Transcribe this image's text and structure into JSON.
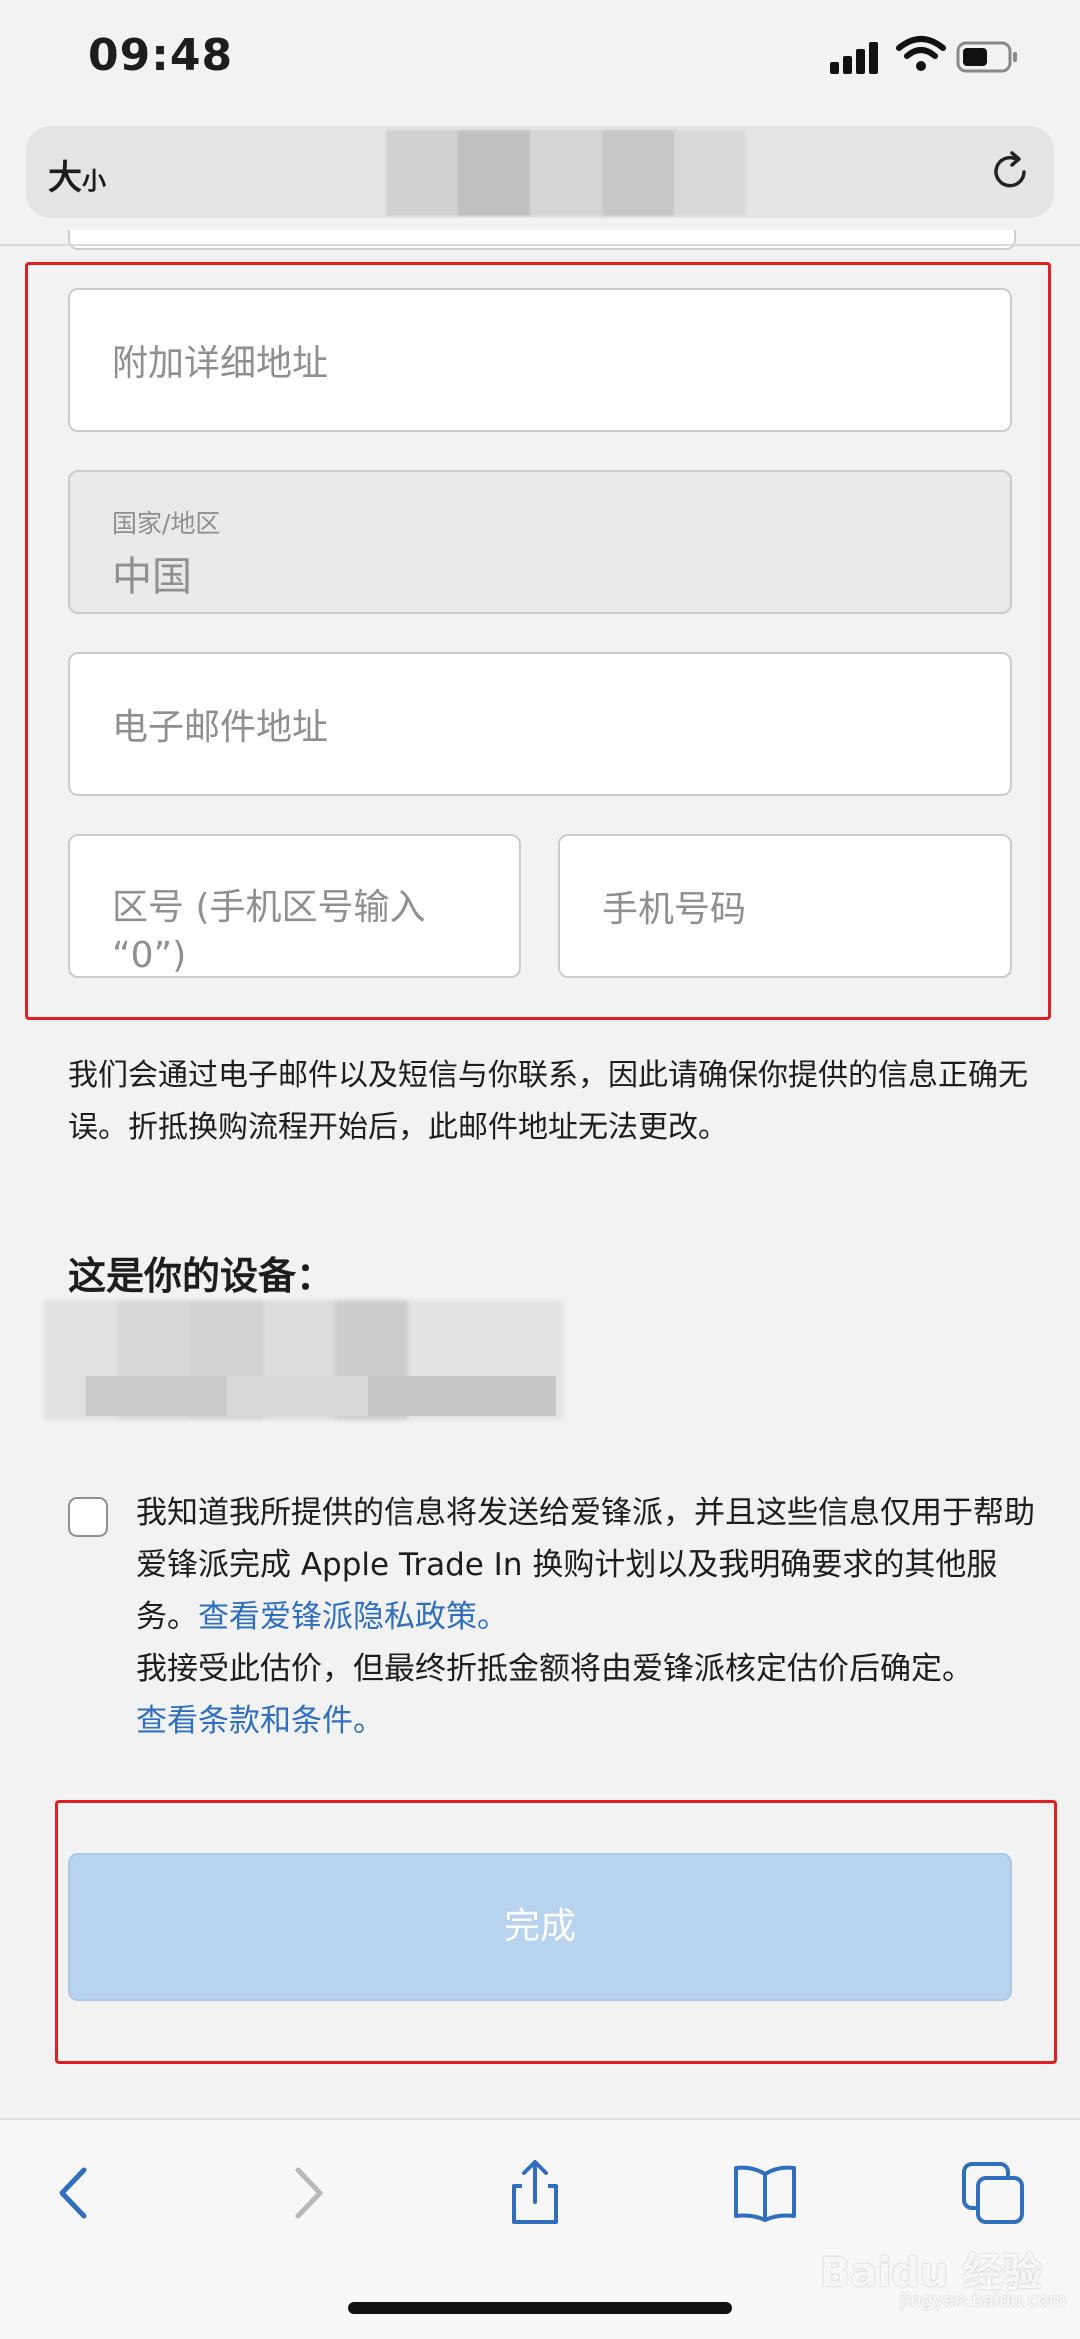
{
  "status_bar": {
    "time": "09:48"
  },
  "browser": {
    "text_size_label": "大",
    "text_size_small": "小"
  },
  "form": {
    "address_extra_placeholder": "附加详细地址",
    "country_label": "国家/地区",
    "country_value": "中国",
    "email_placeholder": "电子邮件地址",
    "area_code_placeholder_line1": "区号 (手机区号输入",
    "area_code_placeholder_line2": "“0”)",
    "phone_placeholder": "手机号码"
  },
  "notice_text": "我们会通过电子邮件以及短信与你联系，因此请确保你提供的信息正确无误。折抵换购流程开始后，此邮件地址无法更改。",
  "device_heading": "这是你的设备：",
  "consent": {
    "line1": "我知道我所提供的信息将发送给爱锋派，并且这些信息仅用于帮助爱锋派完成 Apple Trade In 换购计划以及我明确要求的其他服务。",
    "privacy_link": "查看爱锋派隐私政策。",
    "line2": "我接受此估价，但最终折抵金额将由爱锋派核定估价后确定。",
    "terms_link": "查看条款和条件。"
  },
  "done_button": "完成",
  "watermark": {
    "main": "Baidu 经验",
    "sub": "jingyan.baidu.com"
  },
  "colors": {
    "link": "#2f6fbd",
    "button_disabled": "#b7d3ee",
    "highlight_frame": "#e02020"
  },
  "icons": [
    "back-icon",
    "forward-icon",
    "share-icon",
    "bookmarks-icon",
    "tabs-icon",
    "reload-icon"
  ]
}
